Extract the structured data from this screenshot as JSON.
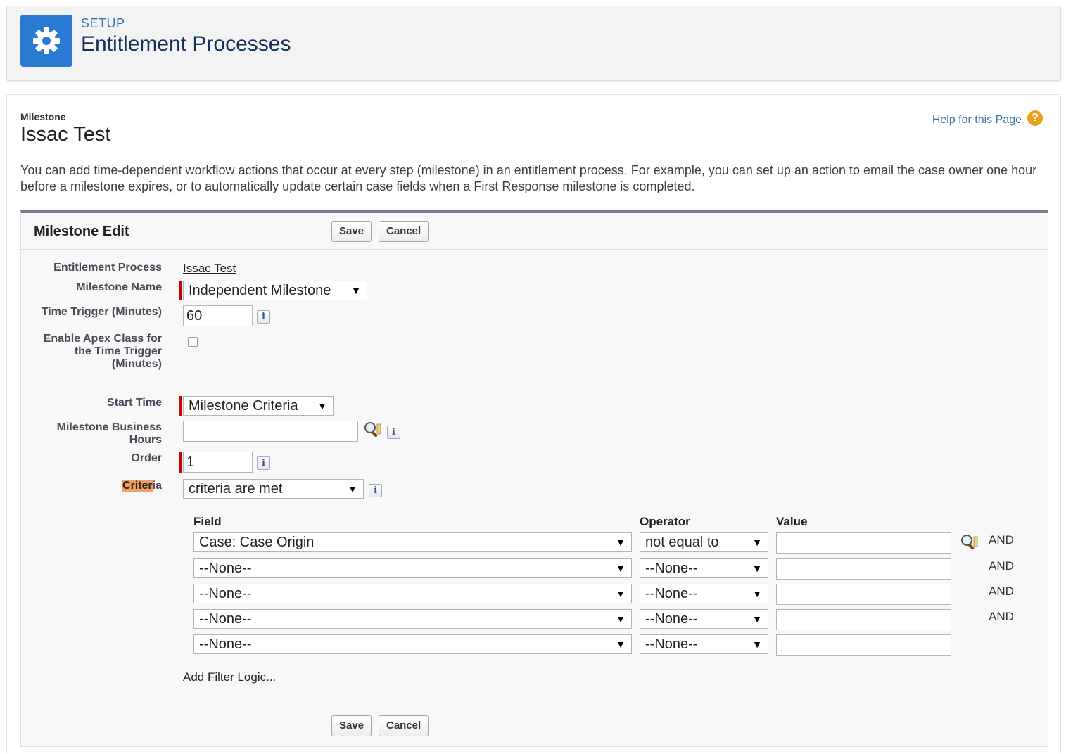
{
  "header": {
    "setup_label": "SETUP",
    "title": "Entitlement Processes",
    "icon": "gear-icon",
    "icon_color": "#2a7ad4"
  },
  "page": {
    "object_type": "Milestone",
    "object_name": "Issac Test",
    "help_link": "Help for this Page",
    "help_icon": "?",
    "intro": "You can add time-dependent workflow actions that occur at every step (milestone) in an entitlement process. For example, you can set up an action to email the case owner one hour before a milestone expires, or to automatically update certain case fields when a First Response milestone is completed."
  },
  "panel": {
    "title": "Milestone Edit",
    "save_label": "Save",
    "cancel_label": "Cancel"
  },
  "form": {
    "entitlement_process_label": "Entitlement Process",
    "entitlement_process_value": "Issac Test",
    "milestone_name_label": "Milestone Name",
    "milestone_name_value": "Independent Milestone",
    "time_trigger_label": "Time Trigger (Minutes)",
    "time_trigger_value": "60",
    "apex_label_line1": "Enable Apex Class for",
    "apex_label_line2": "the Time Trigger",
    "apex_label_line3": "(Minutes)",
    "apex_checked": false,
    "start_time_label": "Start Time",
    "start_time_value": "Milestone Criteria",
    "business_hours_label_line1": "Milestone Business",
    "business_hours_label_line2": "Hours",
    "business_hours_value": "",
    "order_label": "Order",
    "order_value": "1",
    "criteria_label_highlight": "Criter",
    "criteria_label_rest": "ia",
    "criteria_value": "criteria are met",
    "info_glyph": "i"
  },
  "criteria": {
    "field_header": "Field",
    "operator_header": "Operator",
    "value_header": "Value",
    "rows": [
      {
        "field": "Case: Case Origin",
        "operator": "not equal to",
        "value": "",
        "conjunction": "AND"
      },
      {
        "field": "--None--",
        "operator": "--None--",
        "value": "",
        "conjunction": "AND"
      },
      {
        "field": "--None--",
        "operator": "--None--",
        "value": "",
        "conjunction": "AND"
      },
      {
        "field": "--None--",
        "operator": "--None--",
        "value": "",
        "conjunction": "AND"
      },
      {
        "field": "--None--",
        "operator": "--None--",
        "value": "",
        "conjunction": ""
      }
    ],
    "add_filter_logic": "Add Filter Logic..."
  }
}
